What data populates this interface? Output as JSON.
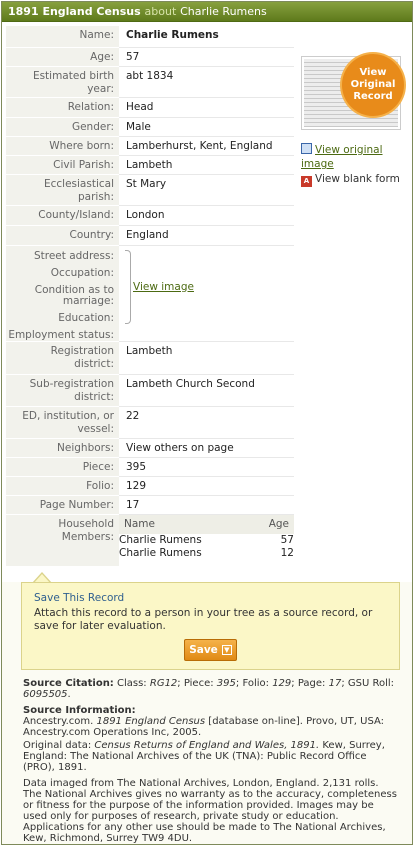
{
  "title": {
    "collection": "1891 England Census",
    "about": "about",
    "person": "Charlie Rumens"
  },
  "record": {
    "name_label": "Name:",
    "name": "Charlie Rumens",
    "age_label": "Age:",
    "age": "57",
    "birth_label": "Estimated birth year:",
    "birth": "abt 1834",
    "relation_label": "Relation:",
    "relation": "Head",
    "gender_label": "Gender:",
    "gender": "Male",
    "born_label": "Where born:",
    "born": "Lamberhurst, Kent, England",
    "civil_label": "Civil Parish:",
    "civil": "Lambeth",
    "eccl_label": "Ecclesiastical parish:",
    "eccl": "St Mary",
    "county_label": "County/Island:",
    "county": "London",
    "country_label": "Country:",
    "country": "England",
    "street_label": "Street address:",
    "occupation_label": "Occupation:",
    "condition_label": "Condition as to marriage:",
    "education_label": "Education:",
    "employment_label": "Employment status:",
    "view_image": "View image",
    "regdist_label": "Registration district:",
    "regdist": "Lambeth",
    "subreg_label": "Sub-registration district:",
    "subreg": "Lambeth Church Second",
    "ed_label": "ED, institution, or vessel:",
    "ed": "22",
    "neighbors_label": "Neighbors:",
    "neighbors": "View others on page",
    "piece_label": "Piece:",
    "piece": "395",
    "folio_label": "Folio:",
    "folio": "129",
    "page_label": "Page Number:",
    "page": "17",
    "household_label": "Household Members:",
    "household_cols": {
      "name": "Name",
      "age": "Age"
    },
    "household": [
      {
        "name": "Charlie Rumens",
        "age": "57"
      },
      {
        "name": "Charlie Rumens",
        "age": "12"
      }
    ]
  },
  "sidebar": {
    "badge": "View Original Record",
    "view_original": "View original image",
    "view_blank": "View blank form"
  },
  "save": {
    "title": "Save This Record",
    "text": "Attach this record to a person in your tree as a source record, or save for later evaluation.",
    "button": "Save"
  },
  "source": {
    "citation_label": "Source Citation:",
    "citation_pre": "Class:",
    "class_val": "RG12",
    "piece_pre": "; Piece:",
    "piece_val": "395",
    "folio_pre": "; Folio:",
    "folio_val": "129",
    "page_pre": "; Page:",
    "page_val": "17",
    "gsu_pre": "; GSU Roll:",
    "gsu_val": "6095505",
    "info_label": "Source Information:",
    "info_a": "Ancestry.com.",
    "info_b": "1891 England Census",
    "info_c": "[database on-line]. Provo, UT, USA: Ancestry.com Operations Inc, 2005.",
    "orig_a": "Original data:",
    "orig_b": "Census Returns of England and Wales, 1891.",
    "orig_c": "Kew, Surrey, England: The National Archives of the UK (TNA): Public Record Office (PRO), 1891.",
    "imaged": "Data imaged from The National Archives, London, England. 2,131 rolls. The National Archives gives no warranty as to the accuracy, completeness or fitness for the purpose of the information provided. Images may be used only for purposes of research, private study or education. Applications for any other use should be made to The National Archives, Kew, Richmond, Surrey TW9 4DU."
  }
}
